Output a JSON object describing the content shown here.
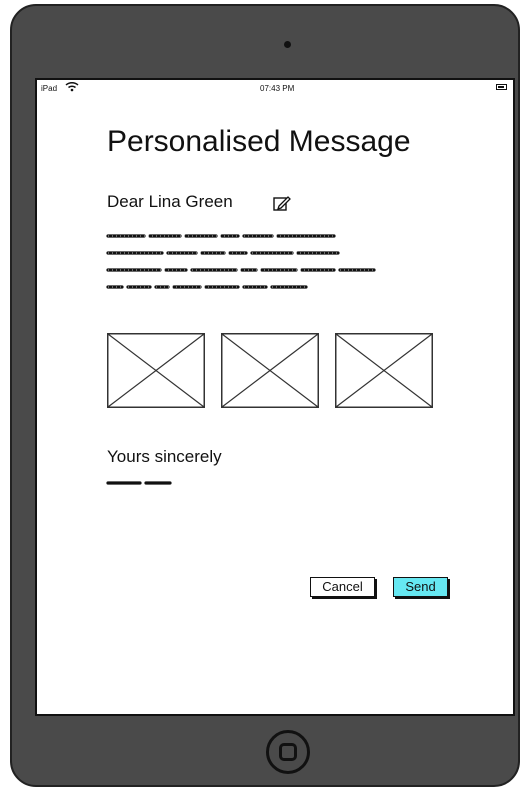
{
  "status_bar": {
    "carrier": "iPad",
    "time": "07:43 PM"
  },
  "message": {
    "title": "Personalised Message",
    "greeting": "Dear Lina Green",
    "closing": "Yours sincerely"
  },
  "actions": {
    "cancel_label": "Cancel",
    "send_label": "Send"
  },
  "icons": {
    "edit": "edit-icon",
    "wifi": "wifi-icon",
    "battery": "battery-icon",
    "image_placeholder": "image-placeholder-icon",
    "home": "home-button-icon"
  },
  "colors": {
    "send_button": "#66e8f2",
    "device_frame": "#4a4a4a"
  }
}
